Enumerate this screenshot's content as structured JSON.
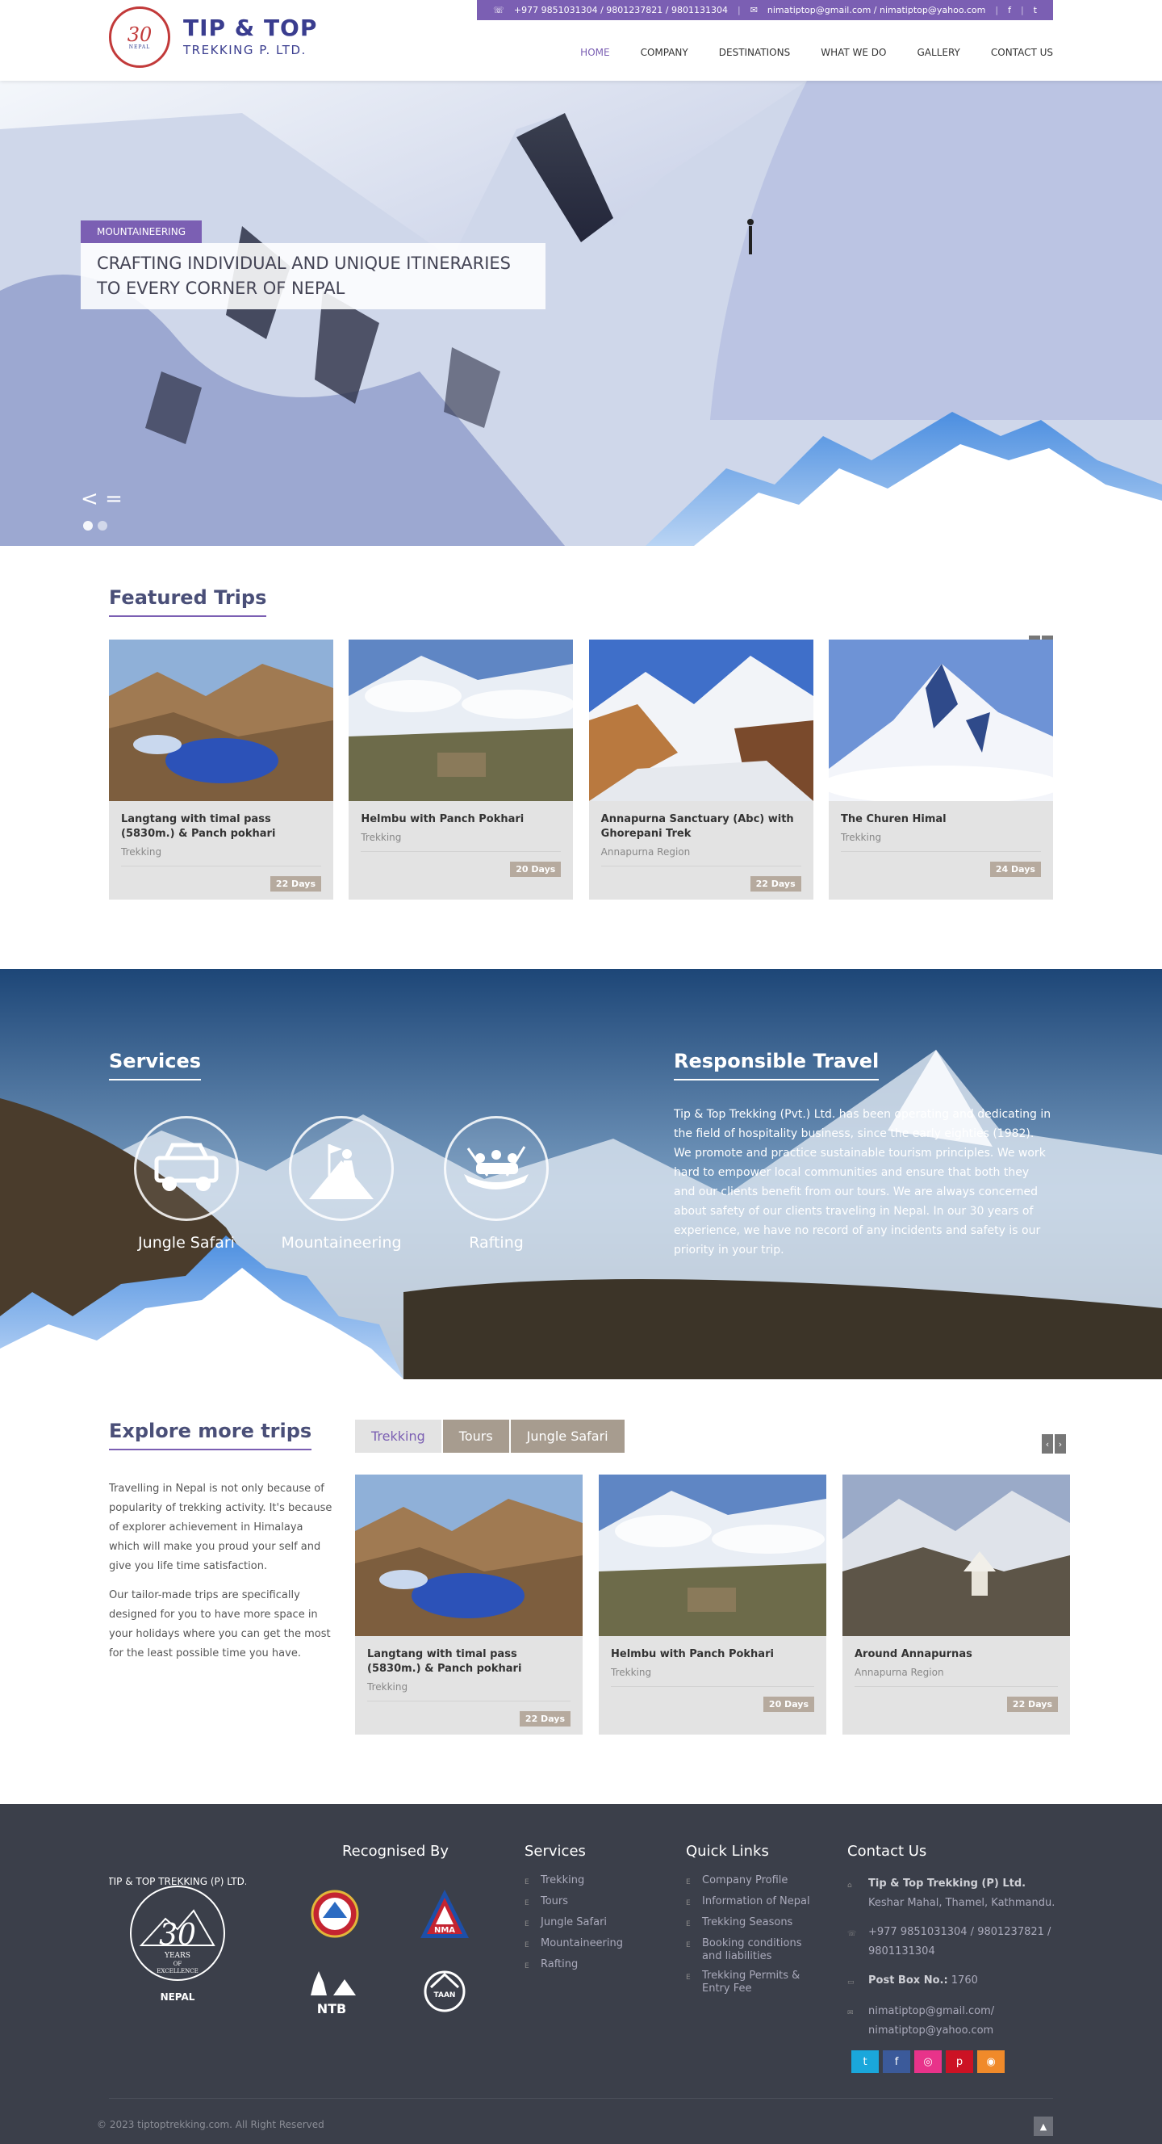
{
  "header": {
    "logo": {
      "badge_number": "30",
      "badge_text": "NEPAL",
      "line1": "TIP & TOP",
      "line2": "TREKKING P. LTD."
    },
    "topbar": {
      "phone_icon": "phone-icon",
      "phones": "+977 9851031304 / 9801237821 / 9801131304",
      "mail_icon": "mail-icon",
      "emails": "nimatiptop@gmail.com / nimatiptop@yahoo.com",
      "social1": "facebook-icon",
      "social2": "twitter-icon"
    },
    "nav": [
      "HOME",
      "COMPANY",
      "DESTINATIONS",
      "WHAT WE DO",
      "GALLERY",
      "CONTACT US"
    ]
  },
  "hero": {
    "tag": "MOUNTAINEERING",
    "title": "CRAFTING INDIVIDUAL AND UNIQUE ITINERARIES TO EVERY CORNER OF NEPAL",
    "prev": "<",
    "menu": "="
  },
  "featured": {
    "title": "Featured Trips",
    "cards": [
      {
        "name": "Langtang with timal pass (5830m.) & Panch pokhari",
        "category": "Trekking",
        "days": "22 Days"
      },
      {
        "name": "Helmbu with Panch Pokhari",
        "category": "Trekking",
        "days": "20 Days"
      },
      {
        "name": "Annapurna Sanctuary (Abc) with Ghorepani Trek",
        "category": "Annapurna Region",
        "days": "22 Days"
      },
      {
        "name": "The Churen Himal",
        "category": "Trekking",
        "days": "24 Days"
      }
    ]
  },
  "services": {
    "title": "Services",
    "items": [
      {
        "label": "Jungle Safari",
        "icon": "jeep-icon"
      },
      {
        "label": "Mountaineering",
        "icon": "climber-icon"
      },
      {
        "label": "Rafting",
        "icon": "raft-icon"
      }
    ]
  },
  "responsible": {
    "title": "Responsible Travel",
    "text": "Tip & Top Trekking (Pvt.) Ltd. has been operating and dedicating in the field of hospitality business, since the early eighties (1982). We promote and practice sustainable tourism principles. We work hard to empower local communities and ensure that both they and our clients benefit from our tours. We are always concerned about safety of our clients traveling in Nepal. In our 30 years of experience, we have no record of any incidents and safety is our priority in your trip."
  },
  "explore": {
    "title": "Explore more trips",
    "p1": "Travelling in Nepal is not only because of popularity of trekking activity. It's because of explorer achievement in Himalaya which will make you proud your self and give you life time satisfaction.",
    "p2": "Our tailor-made trips are specifically designed for you to have more space in your holidays where you can get the most for the least possible time you have.",
    "tabs": [
      "Trekking",
      "Tours",
      "Jungle Safari"
    ],
    "cards": [
      {
        "name": "Langtang with timal pass (5830m.) & Panch pokhari",
        "category": "Trekking",
        "days": "22 Days"
      },
      {
        "name": "Helmbu with Panch Pokhari",
        "category": "Trekking",
        "days": "20 Days"
      },
      {
        "name": "Around Annapurnas",
        "category": "Annapurna Region",
        "days": "22 Days"
      }
    ]
  },
  "footer": {
    "badge": {
      "ring": "TIP & TOP TREKKING (P) LTD.",
      "number": "30",
      "years": "YEARS",
      "of": "OF",
      "excellence": "EXCELLENCE",
      "country": "NEPAL"
    },
    "recognised_title": "Recognised By",
    "recognised": [
      {
        "icon": "nepal-emblem-icon",
        "label": ""
      },
      {
        "icon": "nma-logo-icon",
        "label": "NMA"
      },
      {
        "icon": "ntb-logo-icon",
        "label": "NTB"
      },
      {
        "icon": "taan-logo-icon",
        "label": "TAAN"
      }
    ],
    "services_title": "Services",
    "services": [
      "Trekking",
      "Tours",
      "Jungle Safari",
      "Mountaineering",
      "Rafting"
    ],
    "links_title": "Quick Links",
    "links": [
      "Company Profile",
      "Information of Nepal",
      "Trekking Seasons",
      "Booking conditions and liabilities",
      "Trekking Permits & Entry Fee"
    ],
    "contact_title": "Contact Us",
    "contact": {
      "company": "Tip & Top Trekking (P) Ltd.",
      "address": "Keshar Mahal, Thamel, Kathmandu.",
      "phones": "+977 9851031304 / 9801237821 / 9801131304",
      "pobox_label": "Post Box No.:",
      "pobox": "1760",
      "email1": "nimatiptop@gmail.com/",
      "email2": "nimatiptop@yahoo.com"
    },
    "social": [
      {
        "icon": "twitter-icon",
        "color": "#1aa7db"
      },
      {
        "icon": "facebook-icon",
        "color": "#3b5a9a"
      },
      {
        "icon": "instagram-icon",
        "color": "#e8338a"
      },
      {
        "icon": "pinterest-icon",
        "color": "#cc1224"
      },
      {
        "icon": "rss-icon",
        "color": "#f08a2a"
      }
    ],
    "copyright": "© 2023 tiptoptrekking.com. All Right Reserved"
  },
  "colors": {
    "accent": "#7b5fb3",
    "footer_bg": "#3b3f4a",
    "days_badge": "#b6aa9e"
  }
}
